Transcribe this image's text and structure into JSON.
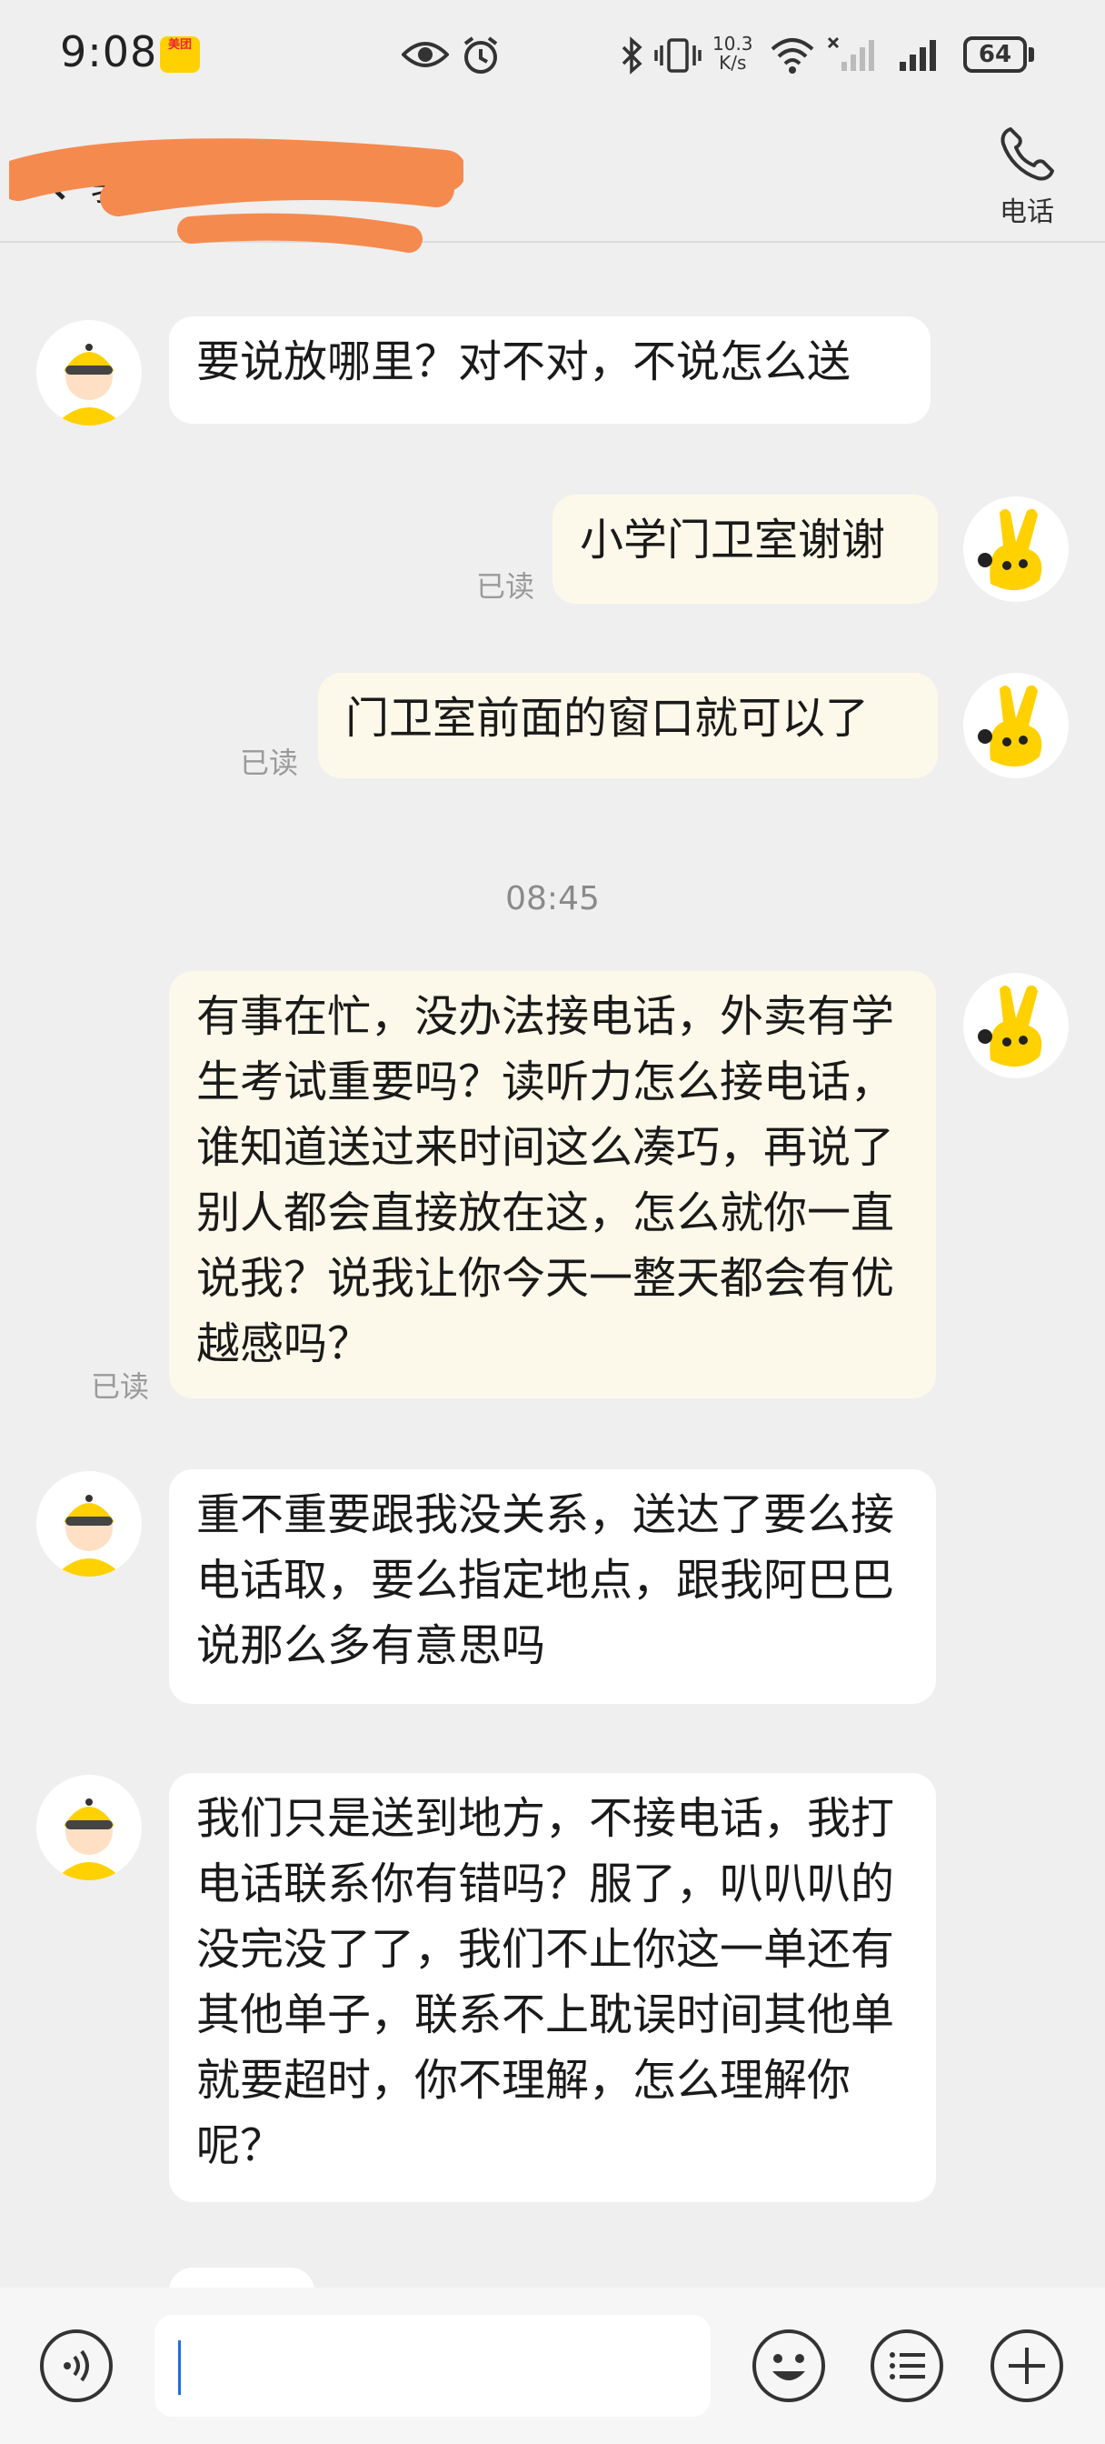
{
  "status_bar": {
    "time": "9:08",
    "app_badge": "美团",
    "network_speed_value": "10.3",
    "network_speed_unit": "K/s",
    "battery": "64"
  },
  "header": {
    "contact_name": "骑手...",
    "call_label": "电话"
  },
  "messages": [
    {
      "sender": "rider",
      "text": "要说放哪里？对不对，不说怎么送"
    },
    {
      "sender": "me",
      "text": "小学门卫室谢谢",
      "read": "已读"
    },
    {
      "sender": "me",
      "text": "门卫室前面的窗口就可以了",
      "read": "已读"
    },
    {
      "sender": "me",
      "text": "有事在忙，没办法接电话，外卖有学生考试重要吗？读听力怎么接电话，谁知道送过来时间这么凑巧，再说了别人都会直接放在这，怎么就你一直说我？说我让你今天一整天都会有优越感吗？",
      "read": "已读"
    },
    {
      "sender": "rider",
      "text": "重不重要跟我没关系，送达了要么接电话取，要么指定地点，跟我阿巴巴说那么多有意思吗"
    },
    {
      "sender": "rider",
      "text": "我们只是送到地方，不接电话，我打电话联系你有错吗？服了，叭叭叭的没完没了了，我们不止你这一单还有其他单子，联系不上耽误时间其他单就要超时，你不理解，怎么理解你呢？"
    }
  ],
  "time_separator": "08:45",
  "input": {
    "value": "",
    "placeholder": ""
  },
  "colors": {
    "my_bubble": "#fdf9ea",
    "rider_bubble": "#ffffff",
    "background": "#efefef",
    "meituan_yellow": "#ffd100"
  }
}
